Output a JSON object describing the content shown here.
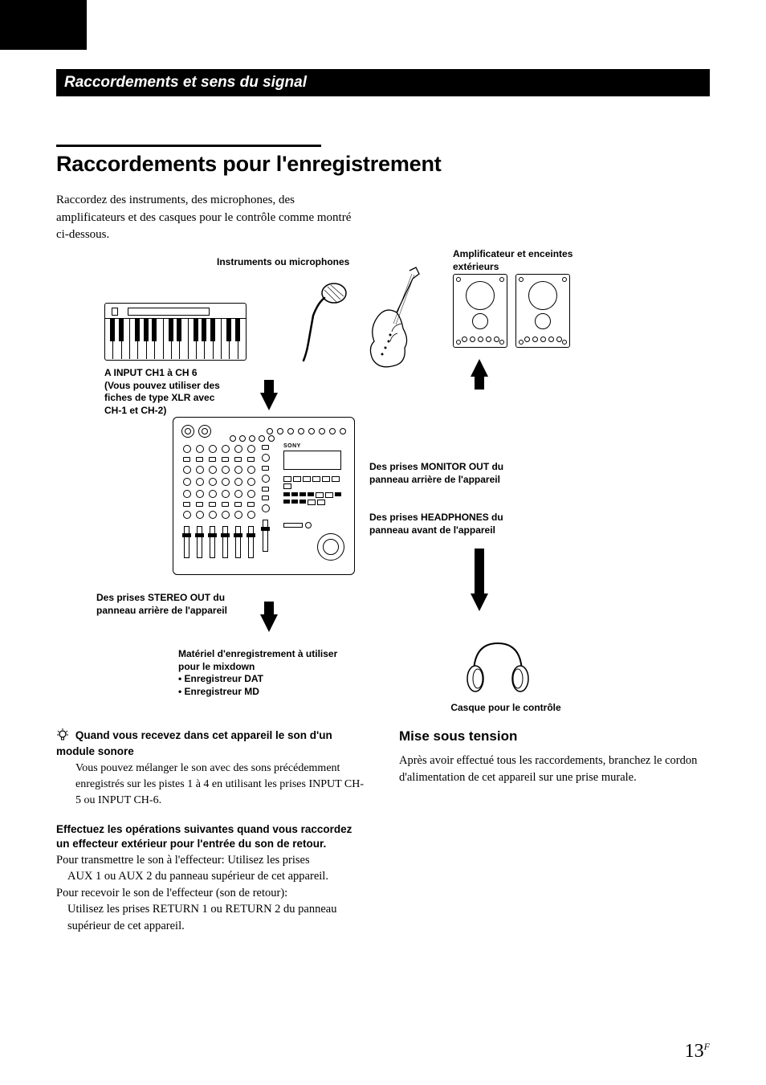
{
  "section_bar": "Raccordements et sens du signal",
  "heading": "Raccordements pour l'enregistrement",
  "intro": "Raccordez des instruments, des microphones, des amplificateurs et des casques pour le contrôle comme montré ci-dessous.",
  "labels": {
    "instruments": "Instruments ou microphones",
    "amp_speakers": "Amplificateur et enceintes extérieurs",
    "input_ch": "A INPUT CH1 à CH 6\n(Vous pouvez utiliser des fiches de type XLR avec CH-1 et CH-2)",
    "monitor_out": "Des prises MONITOR OUT du panneau arrière de l'appareil",
    "headphones_out": "Des prises HEADPHONES du panneau avant de l'appareil",
    "stereo_out": "Des prises STEREO OUT du panneau arrière de l'appareil",
    "recording_eq_title": "Matériel d'enregistrement à utiliser pour le mixdown",
    "recording_eq_1": "• Enregistreur DAT",
    "recording_eq_2": "• Enregistreur MD",
    "headphones_caption": "Casque pour le contrôle",
    "brand": "SONY"
  },
  "tip": {
    "head": "Quand vous recevez dans cet appareil le son d'un module sonore",
    "body": "Vous pouvez mélanger le son avec des sons précédemment enregistrés sur les pistes 1 à 4 en utilisant les prises INPUT CH-5 ou INPUT CH-6."
  },
  "effector": {
    "head": "Effectuez les opérations suivantes quand vous raccordez un effecteur extérieur pour l'entrée du son de retour.",
    "line1a": "Pour transmettre le son à l'effecteur: Utilisez les prises",
    "line1b": "AUX 1 ou AUX 2 du panneau supérieur de cet appareil.",
    "line2a": "Pour recevoir le son de l'effecteur (son de retour):",
    "line2b": "Utilisez les prises RETURN 1 ou RETURN 2 du panneau supérieur de cet appareil."
  },
  "power": {
    "head": "Mise sous tension",
    "body": "Après avoir effectué tous les raccordements, branchez le cordon d'alimentation de cet appareil sur une prise murale."
  },
  "page_number": "13",
  "page_suffix": "F"
}
